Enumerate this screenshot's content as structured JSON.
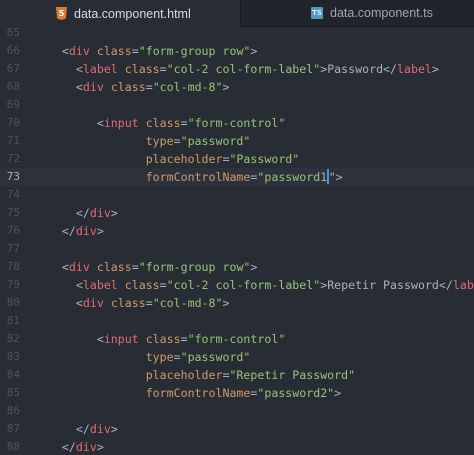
{
  "tabs": [
    {
      "label": "data.component.html",
      "icon": "html5-icon",
      "icon_text": "5",
      "active": true
    },
    {
      "label": "data.component.ts",
      "icon": "typescript-icon",
      "icon_text": "TS",
      "active": false
    }
  ],
  "editor": {
    "cursor_line": 73,
    "lines": [
      {
        "number": 65,
        "segments": []
      },
      {
        "number": 66,
        "segments": [
          {
            "t": "    ",
            "c": "tx"
          },
          {
            "t": "<",
            "c": "pn"
          },
          {
            "t": "div",
            "c": "tg"
          },
          {
            "t": " ",
            "c": "tx"
          },
          {
            "t": "class",
            "c": "at"
          },
          {
            "t": "=",
            "c": "pn"
          },
          {
            "t": "\"form-group row\"",
            "c": "st"
          },
          {
            "t": ">",
            "c": "pn"
          }
        ]
      },
      {
        "number": 67,
        "segments": [
          {
            "t": "      ",
            "c": "tx"
          },
          {
            "t": "<",
            "c": "pn"
          },
          {
            "t": "label",
            "c": "tg"
          },
          {
            "t": " ",
            "c": "tx"
          },
          {
            "t": "class",
            "c": "at"
          },
          {
            "t": "=",
            "c": "pn"
          },
          {
            "t": "\"col-2 col-form-label\"",
            "c": "st"
          },
          {
            "t": ">",
            "c": "pn"
          },
          {
            "t": "Password",
            "c": "tx"
          },
          {
            "t": "</",
            "c": "pn"
          },
          {
            "t": "label",
            "c": "tg"
          },
          {
            "t": ">",
            "c": "pn"
          }
        ]
      },
      {
        "number": 68,
        "segments": [
          {
            "t": "      ",
            "c": "tx"
          },
          {
            "t": "<",
            "c": "pn"
          },
          {
            "t": "div",
            "c": "tg"
          },
          {
            "t": " ",
            "c": "tx"
          },
          {
            "t": "class",
            "c": "at"
          },
          {
            "t": "=",
            "c": "pn"
          },
          {
            "t": "\"col-md-8\"",
            "c": "st"
          },
          {
            "t": ">",
            "c": "pn"
          }
        ]
      },
      {
        "number": 69,
        "segments": []
      },
      {
        "number": 70,
        "segments": [
          {
            "t": "         ",
            "c": "tx"
          },
          {
            "t": "<",
            "c": "pn"
          },
          {
            "t": "input",
            "c": "tg"
          },
          {
            "t": " ",
            "c": "tx"
          },
          {
            "t": "class",
            "c": "at"
          },
          {
            "t": "=",
            "c": "pn"
          },
          {
            "t": "\"form-control\"",
            "c": "st"
          }
        ]
      },
      {
        "number": 71,
        "segments": [
          {
            "t": "                ",
            "c": "tx"
          },
          {
            "t": "type",
            "c": "at"
          },
          {
            "t": "=",
            "c": "pn"
          },
          {
            "t": "\"password\"",
            "c": "st"
          }
        ]
      },
      {
        "number": 72,
        "segments": [
          {
            "t": "                ",
            "c": "tx"
          },
          {
            "t": "placeholder",
            "c": "at"
          },
          {
            "t": "=",
            "c": "pn"
          },
          {
            "t": "\"Password\"",
            "c": "st"
          }
        ]
      },
      {
        "number": 73,
        "segments": [
          {
            "t": "                ",
            "c": "tx"
          },
          {
            "t": "formControlName",
            "c": "at"
          },
          {
            "t": "=",
            "c": "pn"
          },
          {
            "t": "\"password1",
            "c": "st"
          },
          {
            "t": "",
            "c": "cursor"
          },
          {
            "t": "\"",
            "c": "st"
          },
          {
            "t": ">",
            "c": "pn"
          }
        ]
      },
      {
        "number": 74,
        "segments": []
      },
      {
        "number": 75,
        "segments": [
          {
            "t": "      ",
            "c": "tx"
          },
          {
            "t": "</",
            "c": "pn"
          },
          {
            "t": "div",
            "c": "tg"
          },
          {
            "t": ">",
            "c": "pn"
          }
        ]
      },
      {
        "number": 76,
        "segments": [
          {
            "t": "    ",
            "c": "tx"
          },
          {
            "t": "</",
            "c": "pn"
          },
          {
            "t": "div",
            "c": "tg"
          },
          {
            "t": ">",
            "c": "pn"
          }
        ]
      },
      {
        "number": 77,
        "segments": []
      },
      {
        "number": 78,
        "segments": [
          {
            "t": "    ",
            "c": "tx"
          },
          {
            "t": "<",
            "c": "pn"
          },
          {
            "t": "div",
            "c": "tg"
          },
          {
            "t": " ",
            "c": "tx"
          },
          {
            "t": "class",
            "c": "at"
          },
          {
            "t": "=",
            "c": "pn"
          },
          {
            "t": "\"form-group row\"",
            "c": "st"
          },
          {
            "t": ">",
            "c": "pn"
          }
        ]
      },
      {
        "number": 79,
        "segments": [
          {
            "t": "      ",
            "c": "tx"
          },
          {
            "t": "<",
            "c": "pn"
          },
          {
            "t": "label",
            "c": "tg"
          },
          {
            "t": " ",
            "c": "tx"
          },
          {
            "t": "class",
            "c": "at"
          },
          {
            "t": "=",
            "c": "pn"
          },
          {
            "t": "\"col-2 col-form-label\"",
            "c": "st"
          },
          {
            "t": ">",
            "c": "pn"
          },
          {
            "t": "Repetir Password",
            "c": "tx"
          },
          {
            "t": "</",
            "c": "pn"
          },
          {
            "t": "label",
            "c": "tg"
          },
          {
            "t": ">",
            "c": "pn"
          }
        ]
      },
      {
        "number": 80,
        "segments": [
          {
            "t": "      ",
            "c": "tx"
          },
          {
            "t": "<",
            "c": "pn"
          },
          {
            "t": "div",
            "c": "tg"
          },
          {
            "t": " ",
            "c": "tx"
          },
          {
            "t": "class",
            "c": "at"
          },
          {
            "t": "=",
            "c": "pn"
          },
          {
            "t": "\"col-md-8\"",
            "c": "st"
          },
          {
            "t": ">",
            "c": "pn"
          }
        ]
      },
      {
        "number": 81,
        "segments": []
      },
      {
        "number": 82,
        "segments": [
          {
            "t": "         ",
            "c": "tx"
          },
          {
            "t": "<",
            "c": "pn"
          },
          {
            "t": "input",
            "c": "tg"
          },
          {
            "t": " ",
            "c": "tx"
          },
          {
            "t": "class",
            "c": "at"
          },
          {
            "t": "=",
            "c": "pn"
          },
          {
            "t": "\"form-control\"",
            "c": "st"
          }
        ]
      },
      {
        "number": 83,
        "segments": [
          {
            "t": "                ",
            "c": "tx"
          },
          {
            "t": "type",
            "c": "at"
          },
          {
            "t": "=",
            "c": "pn"
          },
          {
            "t": "\"password\"",
            "c": "st"
          }
        ]
      },
      {
        "number": 84,
        "segments": [
          {
            "t": "                ",
            "c": "tx"
          },
          {
            "t": "placeholder",
            "c": "at"
          },
          {
            "t": "=",
            "c": "pn"
          },
          {
            "t": "\"Repetir Password\"",
            "c": "st"
          }
        ]
      },
      {
        "number": 85,
        "segments": [
          {
            "t": "                ",
            "c": "tx"
          },
          {
            "t": "formControlName",
            "c": "at"
          },
          {
            "t": "=",
            "c": "pn"
          },
          {
            "t": "\"password2\"",
            "c": "st"
          },
          {
            "t": ">",
            "c": "pn"
          }
        ]
      },
      {
        "number": 86,
        "segments": []
      },
      {
        "number": 87,
        "segments": [
          {
            "t": "      ",
            "c": "tx"
          },
          {
            "t": "</",
            "c": "pn"
          },
          {
            "t": "div",
            "c": "tg"
          },
          {
            "t": ">",
            "c": "pn"
          }
        ]
      },
      {
        "number": 88,
        "segments": [
          {
            "t": "    ",
            "c": "tx"
          },
          {
            "t": "</",
            "c": "pn"
          },
          {
            "t": "div",
            "c": "tg"
          },
          {
            "t": ">",
            "c": "pn"
          }
        ]
      }
    ]
  }
}
